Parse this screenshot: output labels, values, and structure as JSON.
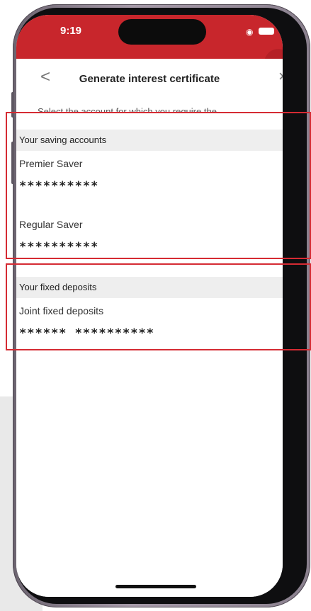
{
  "status_bar": {
    "time": "9:19"
  },
  "header": {
    "title": "Generate interest certificate"
  },
  "intro": {
    "text": "Select the account for which you require the"
  },
  "sections": [
    {
      "title": "Your saving accounts",
      "accounts": [
        {
          "name": "Premier Saver",
          "number": "**********"
        },
        {
          "name": "Regular Saver",
          "number": "**********"
        }
      ]
    },
    {
      "title": "Your fixed deposits",
      "accounts": [
        {
          "name": "Joint fixed deposits",
          "number": "****** **********"
        }
      ]
    }
  ],
  "icons": {
    "back": "<",
    "close": "×",
    "chevron": "›",
    "wifi": "wifi-icon",
    "battery": "battery-icon"
  },
  "colors": {
    "brand": "#c8262c",
    "highlight": "#d52b33",
    "section_bg": "#eeeeee"
  }
}
